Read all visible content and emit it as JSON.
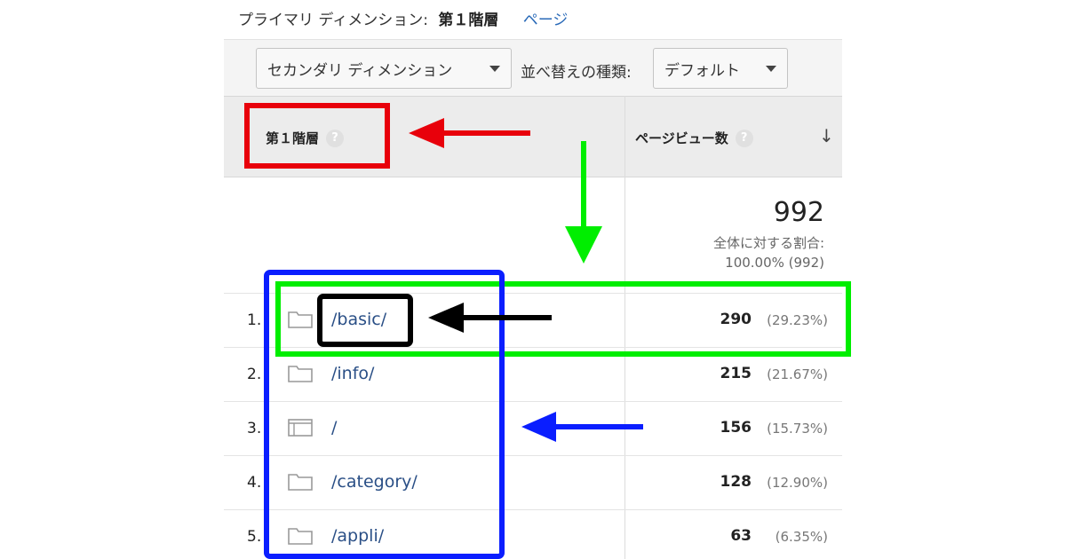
{
  "primary": {
    "label": "プライマリ ディメンション:",
    "current": "第１階層",
    "alt": "ページ"
  },
  "toolbar": {
    "secondary": "セカンダリ ディメンション",
    "sort_label": "並べ替えの種類:",
    "sort_value": "デフォルト"
  },
  "table": {
    "col_dimension": "第１階層",
    "col_pageviews": "ページビュー数",
    "help": "?",
    "summary": {
      "total": "992",
      "label": "全体に対する割合:",
      "pct": "100.00% (992)"
    },
    "rows": [
      {
        "num": "1.",
        "icon": "folder-icon",
        "path": "/basic/",
        "value": "290",
        "pct": "(29.23%)"
      },
      {
        "num": "2.",
        "icon": "folder-icon",
        "path": "/info/",
        "value": "215",
        "pct": "(21.67%)"
      },
      {
        "num": "3.",
        "icon": "page-icon",
        "path": "/",
        "value": "156",
        "pct": "(15.73%)"
      },
      {
        "num": "4.",
        "icon": "folder-icon",
        "path": "/category/",
        "value": "128",
        "pct": "(12.90%)"
      },
      {
        "num": "5.",
        "icon": "folder-icon",
        "path": "/appli/",
        "value": "63",
        "pct": "(6.35%)"
      }
    ]
  },
  "annotations": {
    "red": "#e8000b",
    "green": "#00ee00",
    "blue": "#0a1eff",
    "black": "#000000"
  }
}
